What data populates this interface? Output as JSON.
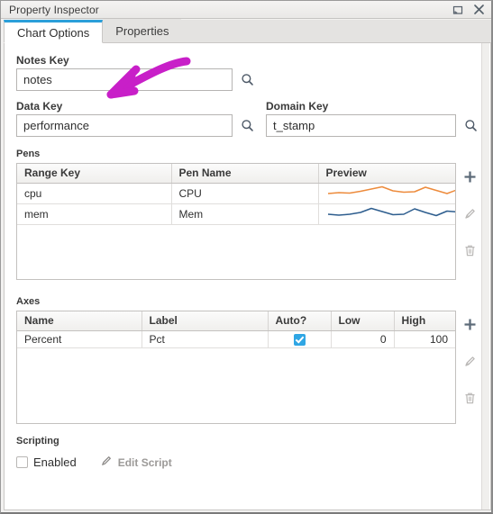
{
  "window": {
    "title": "Property Inspector",
    "buttons": [
      {
        "name": "restore-button",
        "icon": "restore-icon"
      },
      {
        "name": "close-button",
        "icon": "close-icon"
      }
    ]
  },
  "tabs": [
    {
      "label": "Chart Options",
      "active": true
    },
    {
      "label": "Properties",
      "active": false
    }
  ],
  "fields": {
    "notes_key": {
      "label": "Notes Key",
      "value": "notes",
      "placeholder": "",
      "search_icon": "search-icon"
    },
    "data_key": {
      "label": "Data Key",
      "value": "performance",
      "placeholder": "",
      "search_icon": "search-icon"
    },
    "domain_key": {
      "label": "Domain Key",
      "value": "t_stamp",
      "placeholder": "",
      "search_icon": "search-icon"
    }
  },
  "pens": {
    "section_label": "Pens",
    "columns": [
      "Range Key",
      "Pen Name",
      "Preview"
    ],
    "rows": [
      {
        "range_key": "cpu",
        "pen_name": "CPU",
        "preview_color": "#ed8b3c"
      },
      {
        "range_key": "mem",
        "pen_name": "Mem",
        "preview_color": "#2d5d8e"
      }
    ],
    "actions": [
      {
        "name": "add-pen-button",
        "icon": "plus-icon",
        "enabled": true
      },
      {
        "name": "edit-pen-button",
        "icon": "pencil-icon",
        "enabled": false
      },
      {
        "name": "delete-pen-button",
        "icon": "trash-icon",
        "enabled": false
      }
    ]
  },
  "axes": {
    "section_label": "Axes",
    "columns": [
      "Name",
      "Label",
      "Auto?",
      "Low",
      "High"
    ],
    "rows": [
      {
        "name": "Percent",
        "label": "Pct",
        "auto": true,
        "low": "0",
        "high": "100"
      }
    ],
    "actions": [
      {
        "name": "add-axis-button",
        "icon": "plus-icon",
        "enabled": true
      },
      {
        "name": "edit-axis-button",
        "icon": "pencil-icon",
        "enabled": false
      },
      {
        "name": "delete-axis-button",
        "icon": "trash-icon",
        "enabled": false
      }
    ]
  },
  "scripting": {
    "section_label": "Scripting",
    "enabled_label": "Enabled",
    "enabled_checked": false,
    "edit_script_label": "Edit Script",
    "edit_script_icon": "pencil-icon"
  },
  "colors": {
    "accent": "#2b9fd9",
    "checkbox_on": "#2fa6e4",
    "pen_cpu": "#ed8b3c",
    "pen_mem": "#2d5d8e",
    "annotation": "#c81fc8"
  },
  "annotation": {
    "type": "arrow",
    "color": "#c81fc8",
    "points_at": "notes-key-input"
  }
}
